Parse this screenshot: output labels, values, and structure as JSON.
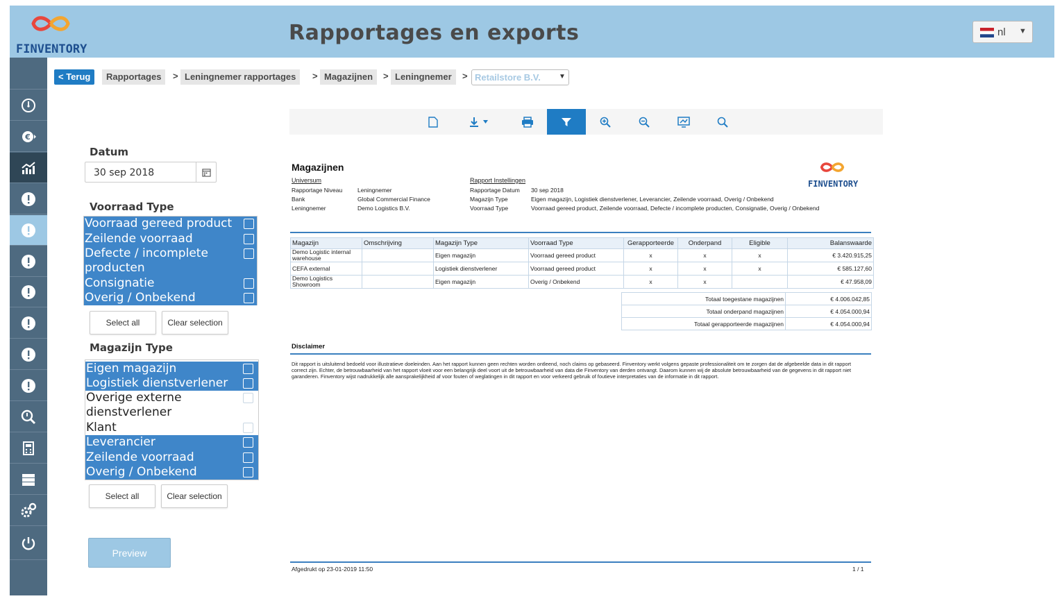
{
  "header": {
    "logo_text": "FINVENTORY",
    "title": "Rapportages en exports",
    "language": {
      "label": "nl",
      "flag": "netherlands-flag-icon"
    }
  },
  "sidebar": {
    "items": [
      {
        "icon": "speedometer-icon"
      },
      {
        "icon": "euro-icon"
      },
      {
        "icon": "chart-icon",
        "active": true
      },
      {
        "icon": "alert-icon"
      },
      {
        "icon": "alert-icon"
      },
      {
        "icon": "alert-icon"
      },
      {
        "icon": "alert-icon"
      },
      {
        "icon": "alert-icon"
      },
      {
        "icon": "alert-icon"
      },
      {
        "icon": "alert-icon"
      },
      {
        "icon": "search-report-icon"
      },
      {
        "icon": "calculator-icon"
      },
      {
        "icon": "database-icon"
      },
      {
        "icon": "settings-icon"
      },
      {
        "icon": "power-icon"
      }
    ]
  },
  "breadcrumb": {
    "back": "< Terug",
    "items": [
      "Rapportages",
      "Leningnemer rapportages",
      "Magazijnen",
      "Leningnemer"
    ],
    "separator": ">",
    "select_value": "Retailstore B.V."
  },
  "filters": {
    "datum_label": "Datum",
    "datum_value": "30 sep 2018",
    "voorraad_label": "Voorraad Type",
    "voorraad_options": [
      {
        "label": "Voorraad gereed product",
        "selected": true
      },
      {
        "label": "Zeilende voorraad",
        "selected": true
      },
      {
        "label": "Defecte / incomplete producten",
        "selected": true
      },
      {
        "label": "Consignatie",
        "selected": true
      },
      {
        "label": "Overig / Onbekend",
        "selected": true
      }
    ],
    "select_all": "Select all",
    "clear_selection": "Clear selection",
    "magazijn_label": "Magazijn Type",
    "magazijn_options": [
      {
        "label": "Eigen magazijn",
        "selected": true
      },
      {
        "label": "Logistiek dienstverlener",
        "selected": true
      },
      {
        "label": "Overige externe dienstverlener",
        "selected": false
      },
      {
        "label": "Klant",
        "selected": false
      },
      {
        "label": "Leverancier",
        "selected": true
      },
      {
        "label": "Zeilende voorraad",
        "selected": true
      },
      {
        "label": "Overig / Onbekend",
        "selected": true
      }
    ],
    "preview": "Preview"
  },
  "toolbar": {
    "buttons": [
      "document-icon",
      "download-icon",
      "print-icon",
      "filter-icon",
      "zoom-in-icon",
      "zoom-out-icon",
      "presentation-icon",
      "search-icon"
    ]
  },
  "report": {
    "title": "Magazijnen",
    "logo_text": "FINVENTORY",
    "universum_label": "Universum",
    "settings_label": "Rapport Instellingen",
    "left_meta": [
      {
        "k": "Rapportage Niveau",
        "v": "Leningnemer"
      },
      {
        "k": "Bank",
        "v": "Global Commercial Finance"
      },
      {
        "k": "Leningnemer",
        "v": "Demo Logistics B.V."
      }
    ],
    "right_meta": [
      {
        "k": "Rapportage Datum",
        "v": "30 sep 2018"
      },
      {
        "k": "Magazijn Type",
        "v": "Eigen magazijn, Logistiek dienstverlener, Leverancier, Zeilende voorraad, Overig / Onbekend"
      },
      {
        "k": "Voorraad Type",
        "v": "Voorraad gereed product, Zeilende voorraad, Defecte / incomplete producten, Consignatie, Overig / Onbekend"
      }
    ],
    "table": {
      "headers": [
        "Magazijn",
        "Omschrijving",
        "Magazijn Type",
        "Voorraad Type",
        "Gerapporteerde",
        "Onderpand",
        "Eligible",
        "Balanswaarde"
      ],
      "rows": [
        [
          "Demo Logistic internal warehouse",
          "",
          "Eigen magazijn",
          "Voorraad gereed product",
          "x",
          "x",
          "x",
          "€ 3.420.915,25"
        ],
        [
          "CEFA external",
          "",
          "Logistiek dienstverlener",
          "Voorraad gereed product",
          "x",
          "x",
          "x",
          "€ 585.127,60"
        ],
        [
          "Demo Logistics Showroom",
          "",
          "Eigen magazijn",
          "Overig / Onbekend",
          "x",
          "x",
          "",
          "€ 47.958,09"
        ]
      ]
    },
    "totals": [
      {
        "label": "Totaal toegestane magazijnen",
        "value": "€ 4.006.042,85"
      },
      {
        "label": "Totaal onderpand magazijnen",
        "value": "€ 4.054.000,94"
      },
      {
        "label": "Totaal gerapporteerde magazijnen",
        "value": "€ 4.054.000,94"
      }
    ],
    "disclaimer_title": "Disclaimer",
    "disclaimer_text": "Dit rapport is uitsluitend bedoeld voor illustratieve doeleinden. Aan het rapport kunnen geen rechten worden ontleend, noch claims op gebaseerd. Finventory werkt volgens gepaste professionaliteit om te zorgen dat de afgebeelde data in dit rapport correct zijn. Echter, de betrouwbaarheid van het rapport vloeit voor een belangrijk deel voort uit de betrouwbaarheid van data die Finventory van derden ontvangt. Daarom kunnen wij de absolute betrouwbaarheid van de gegevens in dit rapport niet garanderen. Finventory wijst nadrukkelijk alle aansprakelijkheid af voor fouten of weglatingen in dit rapport en voor verkeerd gebruik of foutieve interpretaties van de informatie in dit rapport.",
    "footer_left": "Afgedrukt op 23-01-2019 11:50",
    "footer_right": "1 / 1"
  },
  "colors": {
    "header_bg": "#9dc8e4",
    "sidebar_bg": "#4e6a80",
    "accent": "#1f7cc4",
    "selected_bg": "#3f86c9",
    "brand_red": "#e8473d",
    "brand_blue": "#1e4f8f"
  }
}
